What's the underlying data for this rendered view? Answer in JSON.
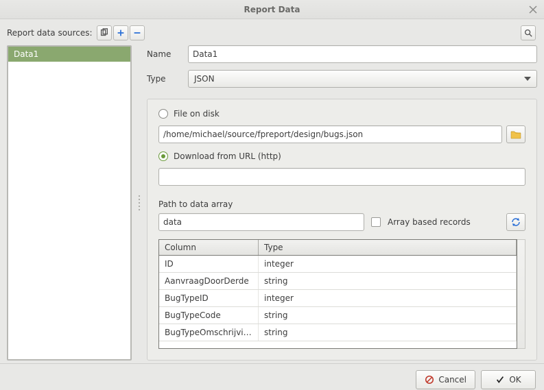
{
  "window": {
    "title": "Report Data"
  },
  "top": {
    "sources_label": "Report data sources:"
  },
  "sources": {
    "items": [
      {
        "name": "Data1"
      }
    ]
  },
  "form": {
    "name_label": "Name",
    "name_value": "Data1",
    "type_label": "Type",
    "type_value": "JSON"
  },
  "settings": {
    "radio_file_label": "File on disk",
    "file_path_value": "/home/michael/source/fpreport/design/bugs.json",
    "radio_url_label": "Download from URL (http)",
    "url_value": "",
    "path_label": "Path to data array",
    "path_value": "data",
    "array_records_label": "Array based records",
    "array_records_checked": false,
    "source_mode": "url",
    "columns_header": {
      "col": "Column",
      "type": "Type"
    },
    "columns": [
      {
        "col": "ID",
        "type": "integer"
      },
      {
        "col": "AanvraagDoorDerde",
        "type": "string"
      },
      {
        "col": "BugTypeID",
        "type": "integer"
      },
      {
        "col": "BugTypeCode",
        "type": "string"
      },
      {
        "col": "BugTypeOmschrijving",
        "type": "string"
      }
    ]
  },
  "footer": {
    "cancel_label": "Cancel",
    "ok_label": "OK"
  }
}
